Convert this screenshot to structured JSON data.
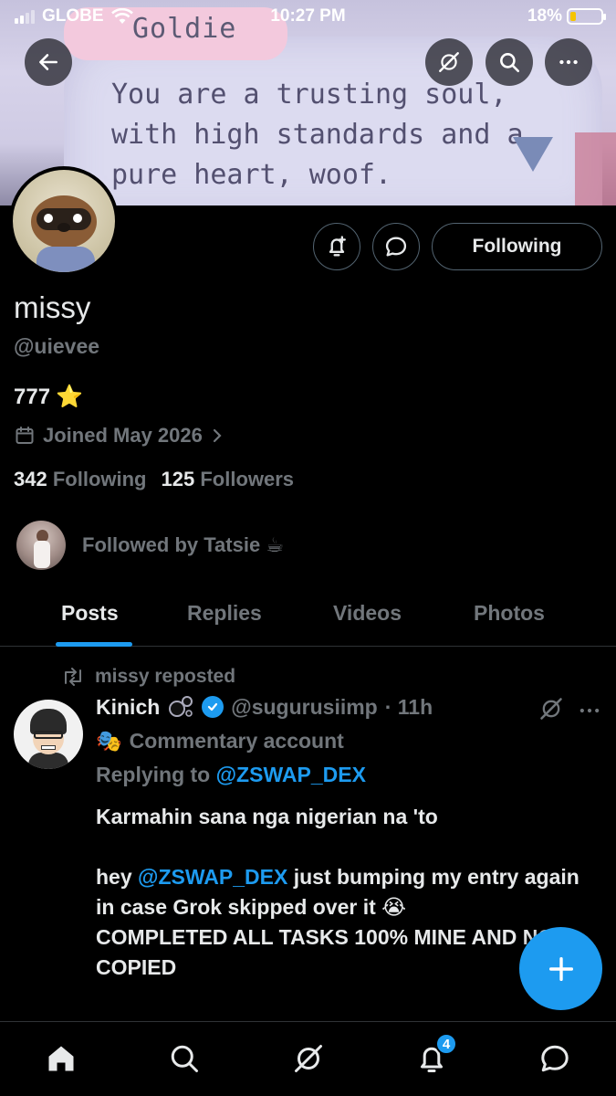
{
  "status_bar": {
    "carrier": "GLOBE",
    "time": "10:27 PM",
    "battery": "18%"
  },
  "banner": {
    "speaker_name": "Goldie",
    "dialog": "You are a trusting soul,\nwith high standards and a\npure heart, woof."
  },
  "profile": {
    "display_name": "missy",
    "handle": "@uievee",
    "bio": "777",
    "bio_emoji": "⭐",
    "joined": "Joined May 2026",
    "following_count": "342",
    "following_label": "Following",
    "followers_count": "125",
    "followers_label": "Followers",
    "followed_by": "Followed by Tatsie ☕",
    "follow_button": "Following"
  },
  "tabs": [
    {
      "label": "Posts",
      "active": true
    },
    {
      "label": "Replies",
      "active": false
    },
    {
      "label": "Videos",
      "active": false
    },
    {
      "label": "Photos",
      "active": false
    }
  ],
  "post": {
    "repost_text": "missy reposted",
    "author_name": "Kinich",
    "author_handle": "@sugurusiimp",
    "time": "· 11h",
    "label": "Commentary account",
    "label_emoji": "🎭",
    "replying_prefix": "Replying to ",
    "replying_to": "@ZSWAP_DEX",
    "line1": "Karmahin sana nga nigerian na 'to",
    "line2_pre": "hey ",
    "line2_mention": "@ZSWAP_DEX",
    "line2_post": " just bumping my entry again in case Grok skipped over it 😭",
    "line3": "COMPLETED ALL TASKS 100% MINE AND NO COPIED"
  },
  "bottom_nav": {
    "notification_count": "4"
  },
  "colors": {
    "accent": "#1d9bf0",
    "muted": "#71767b",
    "text": "#e7e9ea",
    "background": "#000000"
  }
}
